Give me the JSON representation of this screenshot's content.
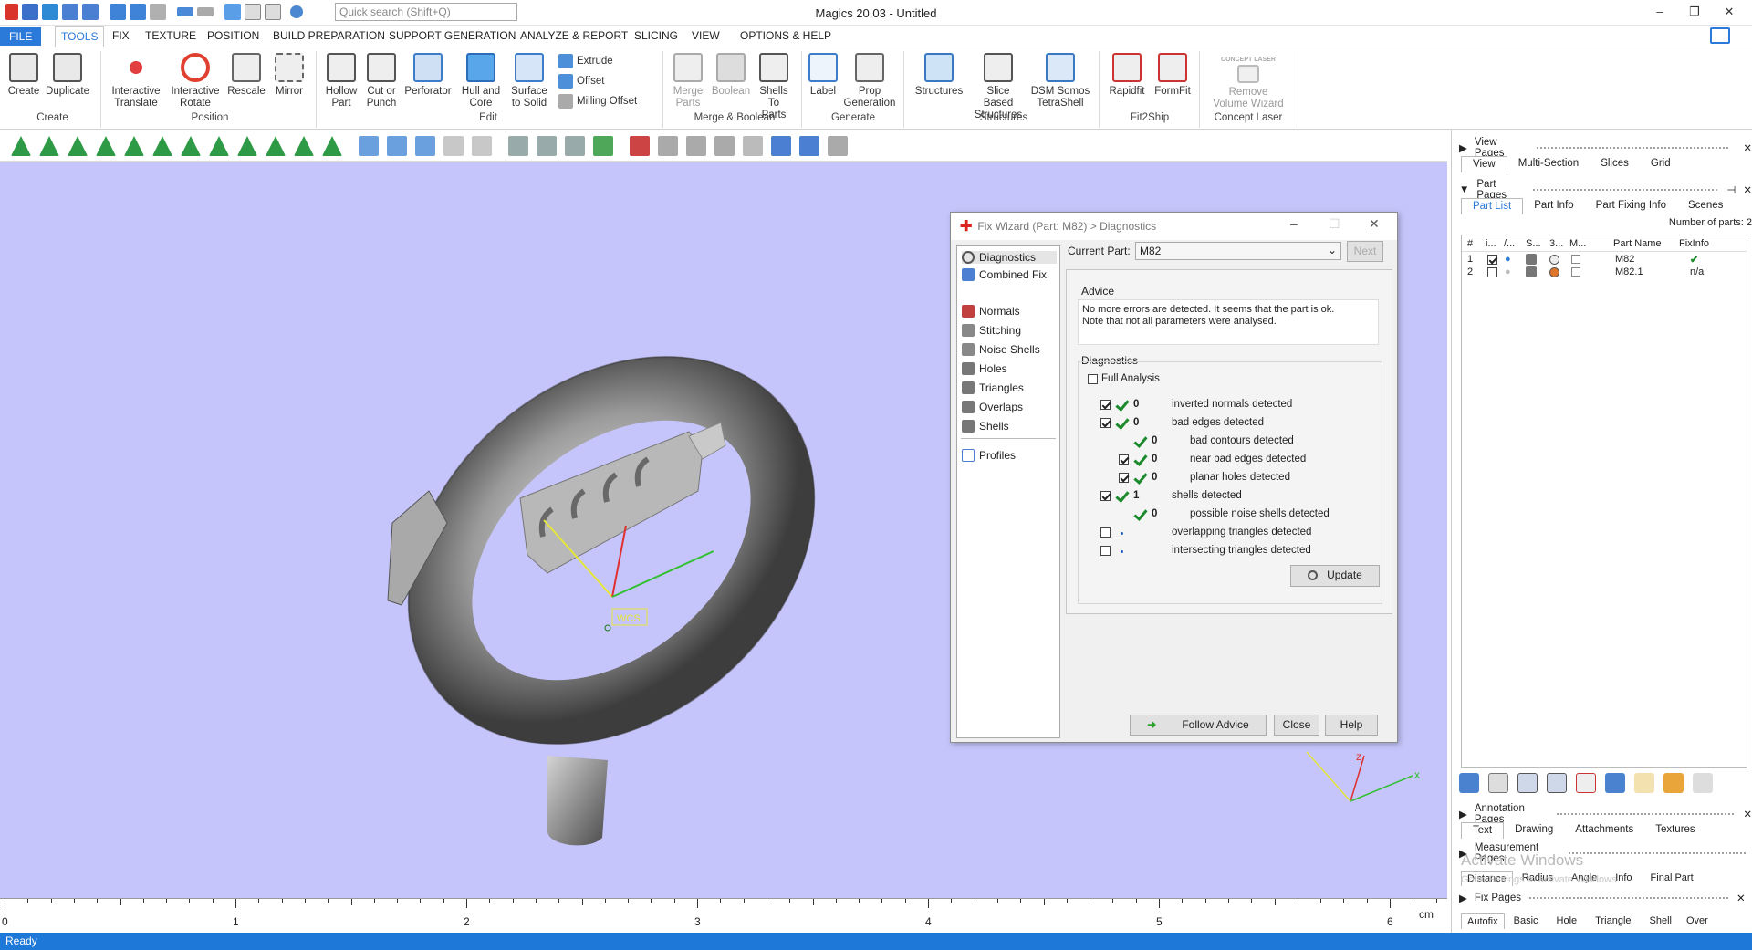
{
  "app": {
    "title": "Magics 20.03 - Untitled",
    "search_placeholder": "Quick search (Shift+Q)",
    "status": "Ready"
  },
  "menu": [
    "FILE",
    "TOOLS",
    "TEXTURE",
    "POSITION",
    "BUILD PREPARATION",
    "SUPPORT GENERATION",
    "ANALYZE & REPORT",
    "SLICING",
    "VIEW",
    "OPTIONS & HELP",
    "FIX"
  ],
  "ribbon": {
    "create": "Create",
    "duplicate": "Duplicate",
    "group_create": "Create",
    "translate": "Interactive Translate",
    "rotate": "Interactive Rotate",
    "rescale": "Rescale",
    "mirror": "Mirror",
    "group_position": "Position",
    "hollow": "Hollow Part",
    "cut": "Cut or Punch",
    "perforator": "Perforator",
    "hull": "Hull and Core",
    "surface": "Surface to Solid",
    "extrude": "Extrude",
    "offset": "Offset",
    "milling": "Milling Offset",
    "group_edit": "Edit",
    "merge": "Merge Parts",
    "boolean": "Boolean",
    "shells": "Shells To Parts",
    "group_merge": "Merge & Boolean",
    "label": "Label",
    "prop": "Prop Generation",
    "group_generate": "Generate",
    "structures": "Structures",
    "slice_structures": "Slice Based Structures",
    "dsm": "DSM Somos TetraShell",
    "group_structures": "Structures",
    "rapidfit": "Rapidfit",
    "formfit": "FormFit",
    "group_fit": "Fit2Ship",
    "remove_volume": "Remove Volume Wizard",
    "concept_logo": "CONCEPT LASER",
    "group_concept": "Concept Laser"
  },
  "viewport": {
    "wcs_label": "WCS",
    "axis_x": "x",
    "axis_z": "z"
  },
  "ruler": {
    "labels": [
      "0",
      "1",
      "2",
      "3",
      "4",
      "5",
      "6"
    ],
    "unit": "cm"
  },
  "right_panel": {
    "view_pages": "View Pages",
    "view_tabs": [
      "View",
      "Multi-Section",
      "Slices",
      "Grid"
    ],
    "part_pages": "Part Pages",
    "part_tabs": [
      "Part List",
      "Part Info",
      "Part Fixing Info",
      "Scenes"
    ],
    "num_parts": "Number of parts: 2",
    "columns": [
      "#",
      "i...",
      "/...",
      "S...",
      "3...",
      "M...",
      "Part Name",
      "FixInfo"
    ],
    "parts": [
      {
        "num": "1",
        "name": "M82",
        "fix": "✔",
        "visible": true,
        "color": "#eeeeee"
      },
      {
        "num": "2",
        "name": "M82.1",
        "fix": "n/a",
        "visible": false,
        "color": "#e0762a"
      }
    ],
    "annotation_pages": "Annotation Pages",
    "annotation_tabs": [
      "Text",
      "Drawing",
      "Attachments",
      "Textures"
    ],
    "measurement_pages": "Measurement Pages",
    "measurement_tabs": [
      "Distance",
      "Radius",
      "Angle",
      "Info",
      "Final Part"
    ],
    "fix_pages": "Fix Pages",
    "fix_tabs": [
      "Autofix",
      "Basic",
      "Hole",
      "Triangle",
      "Shell",
      "Over"
    ],
    "watermark1": "Activate Windows",
    "watermark2": "Go to Settings to activate Windows."
  },
  "dialog": {
    "title": "Fix Wizard (Part: M82) > Diagnostics",
    "nav": [
      "Diagnostics",
      "Combined Fix",
      "Normals",
      "Stitching",
      "Noise Shells",
      "Holes",
      "Triangles",
      "Overlaps",
      "Shells",
      "Profiles"
    ],
    "current_part_label": "Current Part:",
    "current_part": "M82",
    "next": "Next",
    "advice_label": "Advice",
    "advice_text": "No more errors are detected. It seems that the part is ok. Note that not all parameters were analysed.",
    "diagnostics_label": "Diagnostics",
    "full_analysis": "Full Analysis",
    "rows": [
      {
        "indent": 0,
        "checked": true,
        "ok": true,
        "count": "0",
        "label": "inverted normals detected"
      },
      {
        "indent": 0,
        "checked": true,
        "ok": true,
        "count": "0",
        "label": "bad edges detected"
      },
      {
        "indent": 1,
        "checked": null,
        "ok": true,
        "count": "0",
        "label": "bad contours detected"
      },
      {
        "indent": 1,
        "checked": true,
        "ok": true,
        "count": "0",
        "label": "near bad edges detected"
      },
      {
        "indent": 1,
        "checked": true,
        "ok": true,
        "count": "0",
        "label": "planar holes detected"
      },
      {
        "indent": 0,
        "checked": true,
        "ok": true,
        "count": "1",
        "label": "shells detected"
      },
      {
        "indent": 1,
        "checked": null,
        "ok": true,
        "count": "0",
        "label": "possible noise shells detected"
      },
      {
        "indent": 0,
        "checked": false,
        "ok": false,
        "count": "",
        "label": "overlapping triangles detected"
      },
      {
        "indent": 0,
        "checked": false,
        "ok": false,
        "count": "",
        "label": "intersecting triangles detected"
      }
    ],
    "update": "Update",
    "follow_advice": "Follow Advice",
    "close": "Close",
    "help": "Help"
  }
}
